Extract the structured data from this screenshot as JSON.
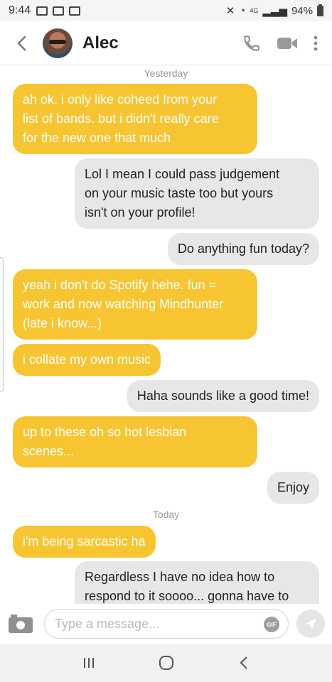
{
  "status_bar": {
    "time": "9:44",
    "battery": "94%",
    "network": "4G"
  },
  "header": {
    "back_icon": "chevron-left-icon",
    "name": "Alec",
    "actions": [
      "phone-icon",
      "video-camera-icon",
      "more-vertical-icon"
    ]
  },
  "chat": {
    "day_labels": [
      "Yesterday",
      "Today"
    ],
    "messages": [
      {
        "dir": "in",
        "text": "ah ok. i only like coheed from your\nlist of bands. but i didn't really care\nfor the new one that much"
      },
      {
        "dir": "out",
        "text": "Lol I mean I could pass judgement\non your music taste too but yours\nisn't on your profile!"
      },
      {
        "dir": "out",
        "text": "Do anything fun today?"
      },
      {
        "dir": "in",
        "text": "yeah i don't do Spotify hehe. fun =\nwork and now watching Mindhunter\n(late i know...)"
      },
      {
        "dir": "in",
        "text": "i collate my own music"
      },
      {
        "dir": "out",
        "text": "Haha sounds like a good time!"
      },
      {
        "dir": "in",
        "text": "up to these oh so hot lesbian\nscenes..."
      },
      {
        "dir": "out",
        "text": "Enjoy"
      },
      {
        "dir": "in",
        "text": "i'm being sarcastic ha"
      },
      {
        "dir": "out",
        "text": "Regardless I have no idea how to\nrespond to it soooo... gonna have to"
      }
    ]
  },
  "composer": {
    "placeholder": "Type a message...",
    "gif_label": "GIF"
  },
  "colors": {
    "incoming": "#f7c532",
    "outgoing": "#e7e7e8"
  }
}
